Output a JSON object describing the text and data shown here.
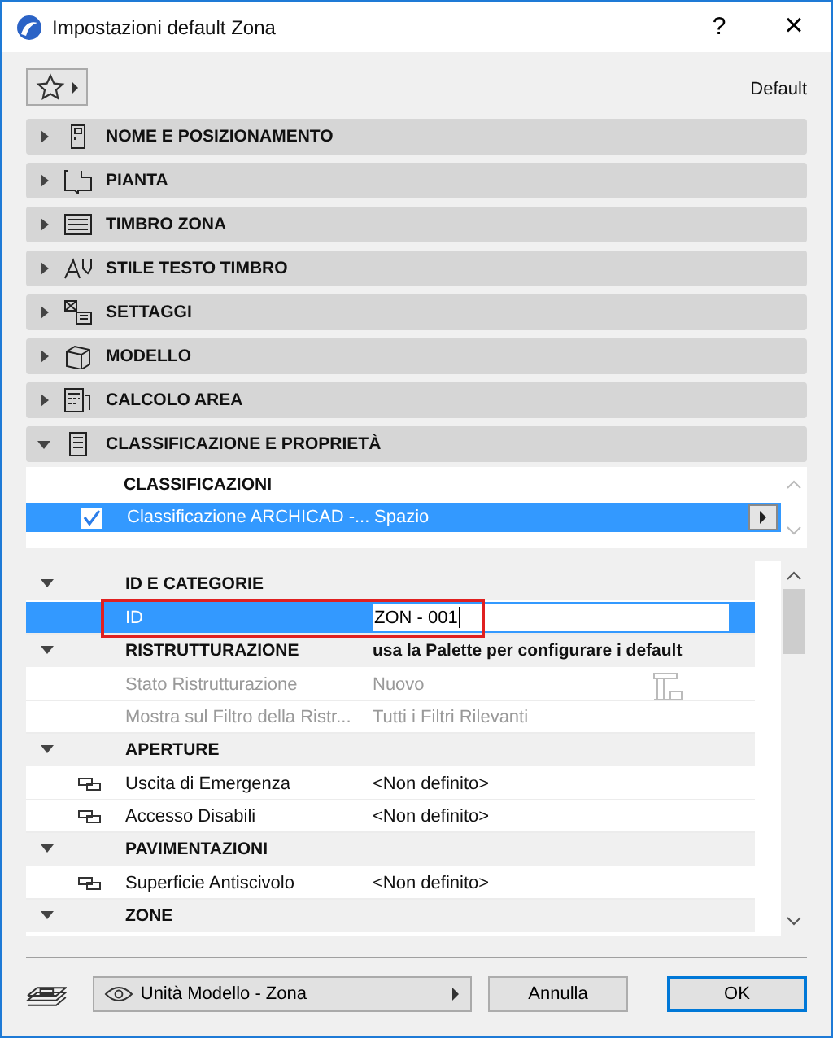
{
  "window": {
    "title": "Impostazioni default Zona",
    "help": "?",
    "close": "×"
  },
  "favorites_label": "Default",
  "panels": [
    {
      "label": "NOME E POSIZIONAMENTO",
      "expanded": false
    },
    {
      "label": "PIANTA",
      "expanded": false
    },
    {
      "label": "TIMBRO ZONA",
      "expanded": false
    },
    {
      "label": "STILE TESTO TIMBRO",
      "expanded": false
    },
    {
      "label": "SETTAGGI",
      "expanded": false
    },
    {
      "label": "MODELLO",
      "expanded": false
    },
    {
      "label": "CALCOLO AREA",
      "expanded": false
    },
    {
      "label": "CLASSIFICAZIONE E PROPRIETÀ",
      "expanded": true
    }
  ],
  "classifications": {
    "heading": "CLASSIFICAZIONI",
    "rows": [
      {
        "name": "Classificazione ARCHICAD -...",
        "value": "Spazio",
        "checked": true,
        "selected": true
      }
    ]
  },
  "properties": [
    {
      "label": "ID E CATEGORIE",
      "expanded": true,
      "children": [
        {
          "kind": "plain",
          "name": "ID",
          "value": "ZON - 001",
          "selected": true,
          "editing": true,
          "highlighted": true,
          "disabled": false
        }
      ]
    },
    {
      "label": "RISTRUTTURAZIONE",
      "value": "usa la Palette per configurare i default",
      "expanded": true,
      "children": [
        {
          "kind": "renovation",
          "name": "Stato Ristrutturazione",
          "value": "Nuovo",
          "selected": false,
          "editing": false,
          "highlighted": false,
          "disabled": true
        },
        {
          "kind": "plain",
          "name": "Mostra sul Filtro della Ristr...",
          "value": "Tutti i Filtri Rilevanti",
          "selected": false,
          "editing": false,
          "highlighted": false,
          "disabled": true
        }
      ]
    },
    {
      "label": "APERTURE",
      "expanded": true,
      "children": [
        {
          "kind": "linked",
          "name": "Uscita di Emergenza",
          "value": "<Non definito>",
          "selected": false,
          "editing": false,
          "highlighted": false,
          "disabled": false
        },
        {
          "kind": "linked",
          "name": "Accesso Disabili",
          "value": "<Non definito>",
          "selected": false,
          "editing": false,
          "highlighted": false,
          "disabled": false
        }
      ]
    },
    {
      "label": "PAVIMENTAZIONI",
      "expanded": true,
      "children": [
        {
          "kind": "linked",
          "name": "Superficie Antiscivolo",
          "value": "<Non definito>",
          "selected": false,
          "editing": false,
          "highlighted": false,
          "disabled": false
        }
      ]
    },
    {
      "label": "ZONE",
      "expanded": true
    }
  ],
  "footer": {
    "view": "Unità Modello - Zona",
    "cancel": "Annulla",
    "ok": "OK"
  }
}
